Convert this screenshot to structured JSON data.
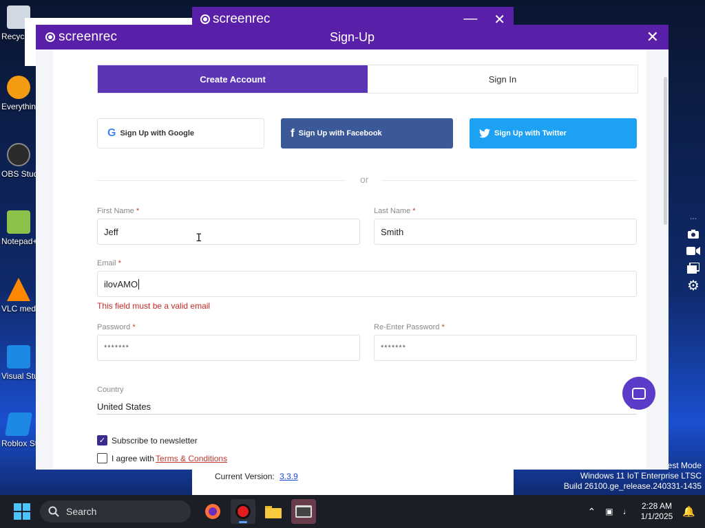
{
  "desktop": {
    "icons": [
      {
        "label": "Recycle Bin",
        "color": "#cfd8e3"
      },
      {
        "label": "Everything",
        "color": "#f39c12"
      },
      {
        "label": "OBS Studio",
        "color": "#2b2b2b"
      },
      {
        "label": "Notepad++",
        "color": "#8bc34a"
      },
      {
        "label": "VLC media player",
        "color": "#ff8800"
      },
      {
        "label": "Visual Studio Code",
        "color": "#1e88e5"
      },
      {
        "label": "Roblox Studio",
        "color": "#1e88e5"
      }
    ]
  },
  "bg_window": {
    "logo": "screenrec",
    "version_label": "Current Version:",
    "version_value": "3.3.9"
  },
  "main_window": {
    "logo": "screenrec",
    "title": "Sign-Up"
  },
  "tabs": [
    {
      "label": "Create Account",
      "active": true
    },
    {
      "label": "Sign In",
      "active": false
    }
  ],
  "social": {
    "google": "Sign Up with Google",
    "facebook": "Sign Up with Facebook",
    "twitter": "Sign Up with Twitter"
  },
  "divider_text": "or",
  "form": {
    "first_name": {
      "label": "First Name",
      "value": "Jeff"
    },
    "last_name": {
      "label": "Last Name",
      "value": "Smith"
    },
    "email": {
      "label": "Email",
      "value": "ilovAMO",
      "error": "This field must be a valid email"
    },
    "password": {
      "label": "Password",
      "value": "*******"
    },
    "reenter_password": {
      "label": "Re-Enter Password",
      "value": "*******"
    },
    "country": {
      "label": "Country",
      "value": "United States"
    },
    "newsletter": {
      "label": "Subscribe to newsletter",
      "checked": true
    },
    "terms": {
      "label": "I agree with",
      "link": "Terms & Conditions",
      "checked": false
    }
  },
  "watermark": {
    "line1": "est Mode",
    "line2": "Windows 11 IoT Enterprise LTSC",
    "line3": "Build 26100.ge_release.240331-1435"
  },
  "taskbar": {
    "search_placeholder": "Search",
    "time": "2:28 AM",
    "date": "1/1/2025"
  },
  "colors": {
    "brand_purple": "#5a1fa8",
    "tab_active": "#5b35b5",
    "facebook": "#3b5998",
    "twitter": "#1da1f2",
    "error": "#c62828"
  }
}
